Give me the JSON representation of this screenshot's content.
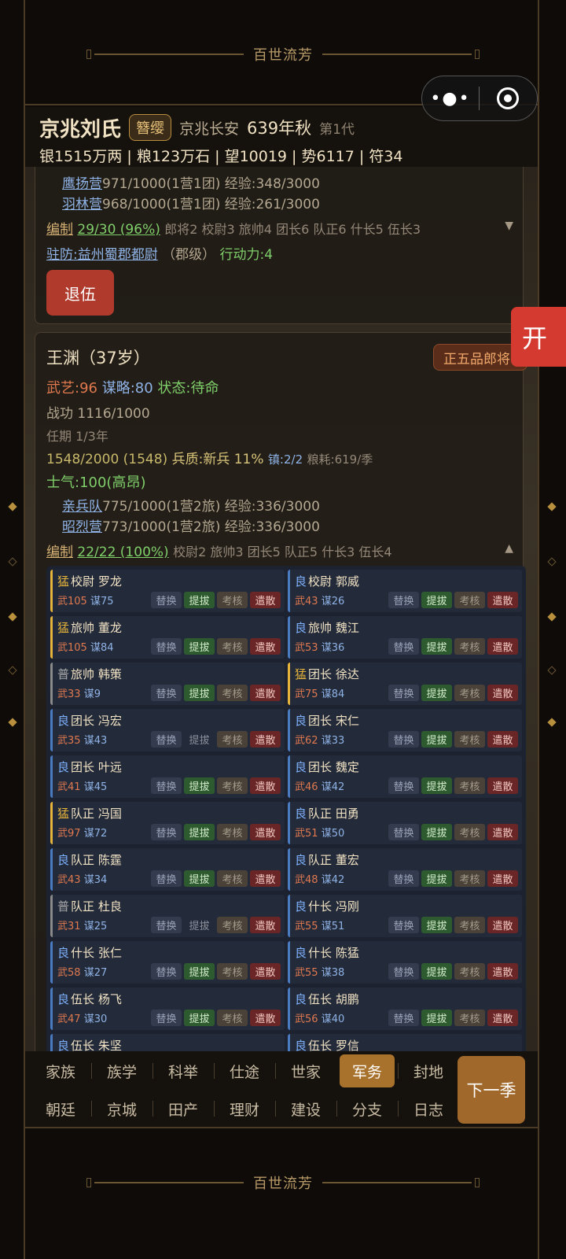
{
  "banner": {
    "title": "百世流芳"
  },
  "capsule": {
    "menu_icon": "more-dots-icon",
    "close_icon": "target-circle-icon"
  },
  "header": {
    "clan_name": "京兆刘氏",
    "badge": "簪缨",
    "location": "京兆长安",
    "year": "639年秋",
    "generation": "第1代",
    "resources": "银1515万两 | 粮123万石 | 望10019 | 势6117 | 符34"
  },
  "card1": {
    "units": [
      {
        "name": "鹰扬营",
        "detail": "971/1000(1营1团) 经验:348/3000"
      },
      {
        "name": "羽林营",
        "detail": "968/1000(1营1团) 经验:261/3000"
      }
    ],
    "org_label": "编制",
    "org_value": "29/30 (96%)",
    "org_detail": "郎将2 校尉3 旅帅4 团长6 队正6 什长5 伍长3",
    "expand_icon": "▼",
    "garrison_label": "驻防:益州蜀郡都尉",
    "garrison_level": "（郡级）",
    "action_power": "行动力:4",
    "retire_label": "退伍"
  },
  "card2": {
    "name": "王渊（37岁）",
    "rank": "正五品郎将",
    "martial": "武艺:96",
    "strategy": "谋略:80",
    "status": "状态:待命",
    "merit": "战功 1116/1000",
    "term": "任期 1/3年",
    "troops": "1548/2000 (1548)",
    "troop_quality": "兵质:新兵 11%",
    "garrison_count": "镇:2/2",
    "grain_use": "粮耗:619/季",
    "morale": "士气:100(高昂)",
    "units": [
      {
        "name": "亲兵队",
        "detail": "775/1000(1营2旅) 经验:336/3000"
      },
      {
        "name": "昭烈营",
        "detail": "773/1000(1营2旅) 经验:336/3000"
      }
    ],
    "org_label": "编制",
    "org_value": "22/22 (100%)",
    "org_detail": "校尉2 旅帅3 团长5 队正5 什长3 伍长4",
    "collapse_icon": "▲"
  },
  "action_labels": {
    "replace": "替换",
    "promote": "提拔",
    "review": "考核",
    "dismiss": "遣散"
  },
  "officers": [
    {
      "quality": "猛",
      "title": "校尉",
      "name": "罗龙",
      "wu": "武105",
      "mou": "谋75",
      "tier": "meng",
      "promote_enabled": true
    },
    {
      "quality": "良",
      "title": "校尉",
      "name": "郭威",
      "wu": "武43",
      "mou": "谋26",
      "tier": "liang",
      "promote_enabled": true
    },
    {
      "quality": "猛",
      "title": "旅帅",
      "name": "董龙",
      "wu": "武105",
      "mou": "谋84",
      "tier": "meng",
      "promote_enabled": true
    },
    {
      "quality": "良",
      "title": "旅帅",
      "name": "魏江",
      "wu": "武53",
      "mou": "谋36",
      "tier": "liang",
      "promote_enabled": true
    },
    {
      "quality": "普",
      "title": "旅帅",
      "name": "韩策",
      "wu": "武33",
      "mou": "谋9",
      "tier": "pu",
      "promote_enabled": true
    },
    {
      "quality": "猛",
      "title": "团长",
      "name": "徐达",
      "wu": "武75",
      "mou": "谋84",
      "tier": "meng",
      "promote_enabled": true
    },
    {
      "quality": "良",
      "title": "团长",
      "name": "冯宏",
      "wu": "武35",
      "mou": "谋43",
      "tier": "liang",
      "promote_enabled": false
    },
    {
      "quality": "良",
      "title": "团长",
      "name": "宋仁",
      "wu": "武62",
      "mou": "谋33",
      "tier": "liang",
      "promote_enabled": true
    },
    {
      "quality": "良",
      "title": "团长",
      "name": "叶远",
      "wu": "武41",
      "mou": "谋45",
      "tier": "liang",
      "promote_enabled": true
    },
    {
      "quality": "良",
      "title": "团长",
      "name": "魏定",
      "wu": "武46",
      "mou": "谋42",
      "tier": "liang",
      "promote_enabled": true
    },
    {
      "quality": "猛",
      "title": "队正",
      "name": "冯国",
      "wu": "武97",
      "mou": "谋72",
      "tier": "meng",
      "promote_enabled": true
    },
    {
      "quality": "良",
      "title": "队正",
      "name": "田勇",
      "wu": "武51",
      "mou": "谋50",
      "tier": "liang",
      "promote_enabled": true
    },
    {
      "quality": "良",
      "title": "队正",
      "name": "陈霆",
      "wu": "武43",
      "mou": "谋34",
      "tier": "liang",
      "promote_enabled": true
    },
    {
      "quality": "良",
      "title": "队正",
      "name": "董宏",
      "wu": "武48",
      "mou": "谋42",
      "tier": "liang",
      "promote_enabled": true
    },
    {
      "quality": "普",
      "title": "队正",
      "name": "杜良",
      "wu": "武31",
      "mou": "谋25",
      "tier": "pu",
      "promote_enabled": false
    },
    {
      "quality": "良",
      "title": "什长",
      "name": "冯刚",
      "wu": "武55",
      "mou": "谋51",
      "tier": "liang",
      "promote_enabled": true
    },
    {
      "quality": "良",
      "title": "什长",
      "name": "张仁",
      "wu": "武58",
      "mou": "谋27",
      "tier": "liang",
      "promote_enabled": true
    },
    {
      "quality": "良",
      "title": "什长",
      "name": "陈猛",
      "wu": "武55",
      "mou": "谋38",
      "tier": "liang",
      "promote_enabled": true
    },
    {
      "quality": "良",
      "title": "伍长",
      "name": "杨飞",
      "wu": "武47",
      "mou": "谋30",
      "tier": "liang",
      "promote_enabled": true
    },
    {
      "quality": "良",
      "title": "伍长",
      "name": "胡鹏",
      "wu": "武56",
      "mou": "谋40",
      "tier": "liang",
      "promote_enabled": true
    },
    {
      "quality": "良",
      "title": "伍长",
      "name": "朱坚",
      "wu": "",
      "mou": "",
      "tier": "liang",
      "promote_enabled": true
    },
    {
      "quality": "良",
      "title": "伍长",
      "name": "罗信",
      "wu": "",
      "mou": "",
      "tier": "liang",
      "promote_enabled": true
    }
  ],
  "float_button": {
    "label": "开"
  },
  "nav": {
    "row1": [
      "家族",
      "族学",
      "科举",
      "仕途",
      "世家",
      "军务",
      "封地"
    ],
    "row2": [
      "朝廷",
      "京城",
      "田产",
      "理财",
      "建设",
      "分支",
      "日志"
    ],
    "active": "军务",
    "next_label": "下一季"
  }
}
